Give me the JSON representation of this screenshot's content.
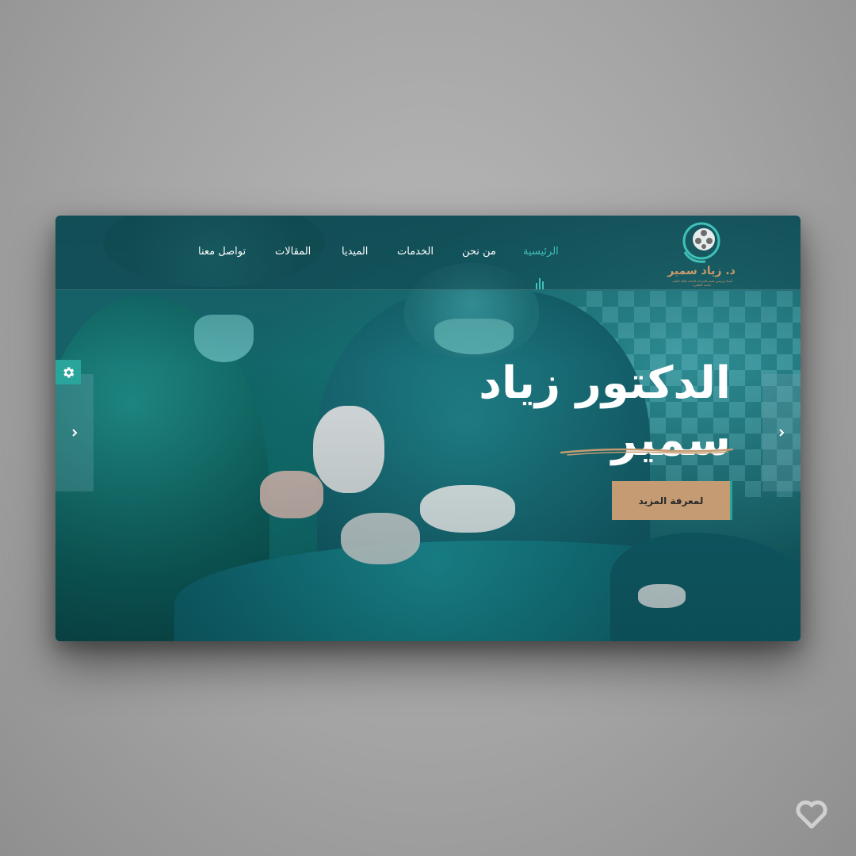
{
  "header": {
    "nav": [
      {
        "label": "الرئيسية",
        "active": true
      },
      {
        "label": "من نحن",
        "active": false
      },
      {
        "label": "الخدمات",
        "active": false
      },
      {
        "label": "الميديا",
        "active": false
      },
      {
        "label": "المقالات",
        "active": false
      },
      {
        "label": "تواصل معنا",
        "active": false
      }
    ],
    "logo": {
      "text": "د. زياد سمير",
      "subtitle": "أستاذ ورئيس قسم الجراحة العامة بكلية الطب جامعة القاهرة"
    }
  },
  "hero": {
    "title_line1": "الدكتور زياد",
    "title_line2": "سمير",
    "cta_label": "لمعرفة المزيد"
  },
  "icons": {
    "left_arrow": "chevron-left-icon",
    "right_arrow": "chevron-right-icon",
    "settings": "gear-icon",
    "watermark": "heart-icon"
  },
  "colors": {
    "accent": "#3fc1b8",
    "button": "#c49b72",
    "brand_gold": "#c89a6a",
    "overlay": "#145e64"
  }
}
